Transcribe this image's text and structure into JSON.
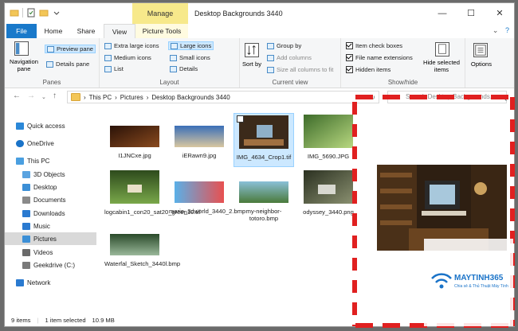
{
  "window": {
    "title": "Desktop Backgrounds 3440",
    "manage_label": "Manage",
    "controls": {
      "minimize": "—",
      "maximize": "☐",
      "close": "✕"
    }
  },
  "tabs": {
    "file": "File",
    "home": "Home",
    "share": "Share",
    "view": "View",
    "picture_tools": "Picture Tools",
    "expand": "⌄",
    "help": "?"
  },
  "ribbon": {
    "panes": {
      "label": "Panes",
      "navigation_pane": "Navigation pane",
      "preview_pane": "Preview pane",
      "details_pane": "Details pane"
    },
    "layout": {
      "label": "Layout",
      "extra_large": "Extra large icons",
      "large": "Large icons",
      "medium": "Medium icons",
      "small": "Small icons",
      "list": "List",
      "details": "Details"
    },
    "current_view": {
      "label": "Current view",
      "sort_by": "Sort by",
      "group_by": "Group by",
      "add_columns": "Add columns",
      "size_all": "Size all columns to fit"
    },
    "show_hide": {
      "label": "Show/hide",
      "item_check_boxes": "Item check boxes",
      "file_name_extensions": "File name extensions",
      "hidden_items": "Hidden items",
      "hide_selected": "Hide selected items"
    },
    "options": "Options"
  },
  "address": {
    "path": [
      "This PC",
      "Pictures",
      "Desktop Backgrounds 3440"
    ],
    "search_placeholder": "Search Desktop Backgrounds..."
  },
  "nav": {
    "items": [
      {
        "label": "Quick access",
        "color": "#2b88d8"
      },
      {
        "label": "OneDrive",
        "color": "#1a73c8"
      },
      {
        "label": "This PC",
        "color": "#4a9fe0"
      },
      {
        "label": "3D Objects",
        "color": "#5aa3e0"
      },
      {
        "label": "Desktop",
        "color": "#3c8fd6"
      },
      {
        "label": "Documents",
        "color": "#8a8a8a"
      },
      {
        "label": "Downloads",
        "color": "#2a7ad0"
      },
      {
        "label": "Music",
        "color": "#2a7ad0"
      },
      {
        "label": "Pictures",
        "color": "#3c8fd6"
      },
      {
        "label": "Videos",
        "color": "#6a6a6a"
      },
      {
        "label": "Geekdrive (C:)",
        "color": "#7a7a7a"
      },
      {
        "label": "Network",
        "color": "#2a7ad0"
      }
    ]
  },
  "files": [
    {
      "name": "I1JNCxe.jpg",
      "colors": [
        "#2a1208",
        "#8a4a1e"
      ]
    },
    {
      "name": "iERawn9.jpg",
      "colors": [
        "#3a6fb8",
        "#d9c7a0"
      ]
    },
    {
      "name": "IMG_4634_Crop1.tif",
      "colors": [
        "#3b2a1a",
        "#a07040"
      ]
    },
    {
      "name": "IMG_5690.JPG",
      "colors": [
        "#3d6b2a",
        "#b8d880"
      ]
    },
    {
      "name": "logcabin1_con20_sat20_green10.tif",
      "colors": [
        "#2d4a1c",
        "#7aa84a"
      ]
    },
    {
      "name": "mario_3dworld_3440_2.bmp",
      "colors": [
        "#5ab0e8",
        "#e85050"
      ]
    },
    {
      "name": "my-neighbor-totoro.bmp",
      "colors": [
        "#4a7a3a",
        "#8ac0d8"
      ]
    },
    {
      "name": "odyssey_3440.png",
      "colors": [
        "#2a3020",
        "#8a9070"
      ]
    },
    {
      "name": "Waterfal_Sketch_3440l.bmp",
      "colors": [
        "#2a4a2a",
        "#9ab89a"
      ]
    }
  ],
  "status": {
    "items": "9 items",
    "selected": "1 item selected",
    "size": "10.9 MB"
  },
  "watermark": {
    "brand": "MAYTINH365",
    "tagline": "Chia sẻ & Thủ Thuật Máy Tính"
  }
}
